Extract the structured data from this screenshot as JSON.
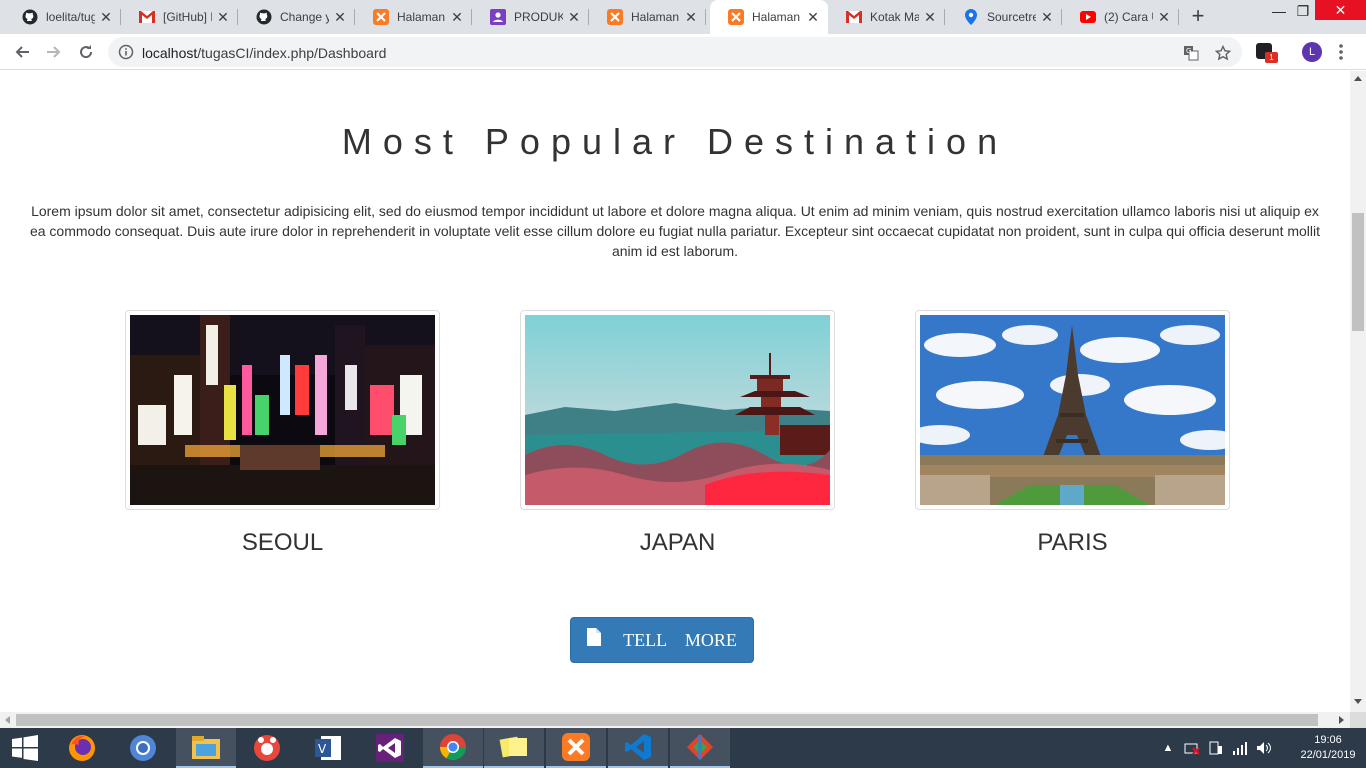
{
  "browser": {
    "tabs": [
      {
        "label": "loelita/tug",
        "icon": "github-icon",
        "active": false
      },
      {
        "label": "[GitHub] N",
        "icon": "gmail-icon",
        "active": false
      },
      {
        "label": "Change y",
        "icon": "github-icon",
        "active": false
      },
      {
        "label": "Halaman",
        "icon": "xampp-icon",
        "active": false
      },
      {
        "label": "PRODUKT",
        "icon": "account-icon",
        "active": false
      },
      {
        "label": "Halaman",
        "icon": "xampp-icon",
        "active": false
      },
      {
        "label": "Halaman",
        "icon": "xampp-icon",
        "active": true
      },
      {
        "label": "Kotak Ma",
        "icon": "gmail-icon",
        "active": false
      },
      {
        "label": "Sourcetre",
        "icon": "maps-pin-icon",
        "active": false
      },
      {
        "label": "(2) Cara U",
        "icon": "youtube-icon",
        "active": false
      }
    ],
    "url_host": "localhost",
    "url_path": "/tugasCI/index.php/Dashboard",
    "profile_initial": "L",
    "extension_badge": "1"
  },
  "page": {
    "heading": "Most Popular Destination",
    "intro": "Lorem ipsum dolor sit amet, consectetur adipisicing elit, sed do eiusmod tempor incididunt ut labore et dolore magna aliqua. Ut enim ad minim veniam, quis nostrud exercitation ullamco laboris nisi ut aliquip ex ea commodo consequat. Duis aute irure dolor in reprehenderit in voluptate velit esse cillum dolore eu fugiat nulla pariatur. Excepteur sint occaecat cupidatat non proident, sunt in culpa qui officia deserunt mollit anim id est laborum.",
    "destinations": [
      {
        "name": "SEOUL"
      },
      {
        "name": "JAPAN"
      },
      {
        "name": "PARIS"
      }
    ],
    "button_label": "TELL MORE"
  },
  "taskbar": {
    "time": "19:06",
    "date": "22/01/2019"
  },
  "colors": {
    "button": "#337ab7",
    "tabstrip": "#dee1e6",
    "taskbar": "#2d3a4a"
  }
}
